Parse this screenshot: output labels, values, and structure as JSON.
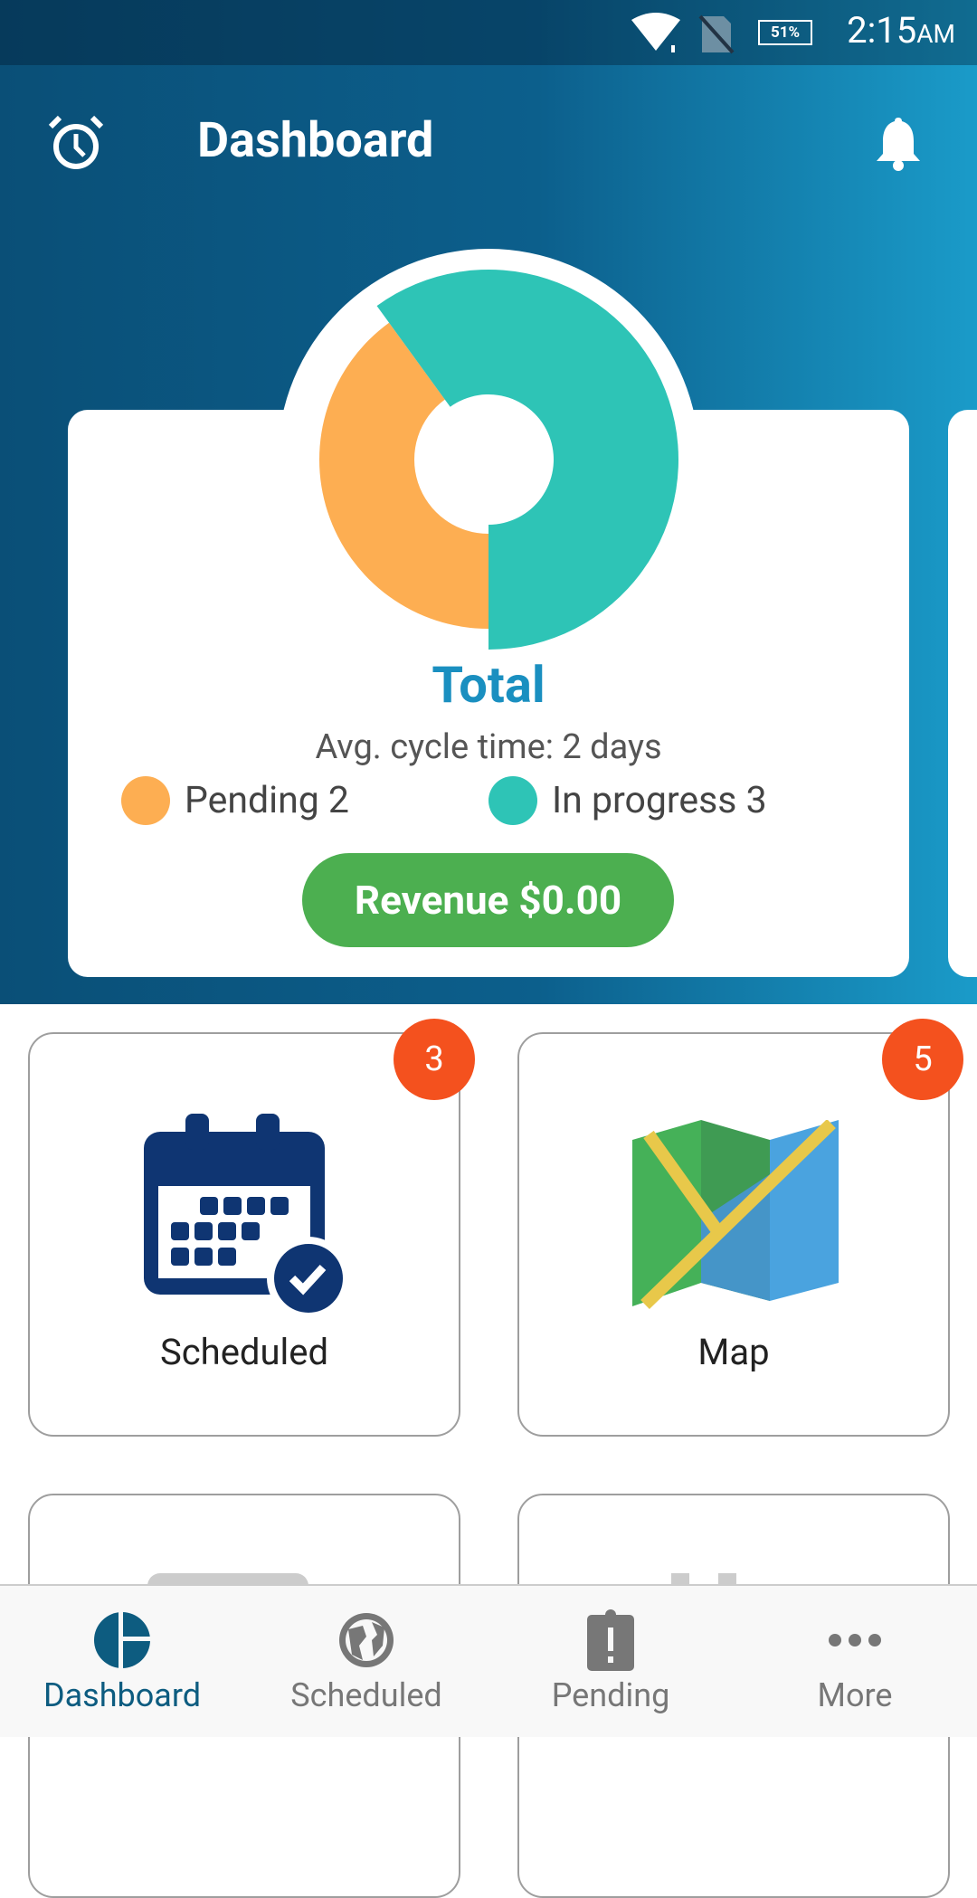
{
  "status_bar": {
    "battery": "51%",
    "time": "2:15",
    "ampm": "AM"
  },
  "header": {
    "title": "Dashboard",
    "left_icon": "alarm-clock-icon",
    "right_icon": "bell-icon"
  },
  "summary": {
    "title": "Total",
    "avg_cycle": "Avg. cycle time: 2 days",
    "legend": [
      {
        "label": "Pending 2",
        "color": "#fdae52"
      },
      {
        "label": "In progress 3",
        "color": "#2ec4b6"
      }
    ],
    "revenue": "Revenue $0.00"
  },
  "chart_data": {
    "type": "pie",
    "categories": [
      "Pending",
      "In progress"
    ],
    "values": [
      2,
      3
    ],
    "colors": [
      "#fdae52",
      "#2ec4b6"
    ]
  },
  "tiles": [
    {
      "label": "Scheduled",
      "badge": "3",
      "icon": "calendar-check-icon"
    },
    {
      "label": "Map",
      "badge": "5",
      "icon": "map-icon"
    }
  ],
  "bottom_nav": [
    {
      "label": "Dashboard",
      "icon": "dashboard-pie-icon",
      "active": true
    },
    {
      "label": "Scheduled",
      "icon": "globe-icon"
    },
    {
      "label": "Pending",
      "icon": "clipboard-alert-icon"
    },
    {
      "label": "More",
      "icon": "more-dots-icon"
    }
  ],
  "accent": "#0d5c80"
}
